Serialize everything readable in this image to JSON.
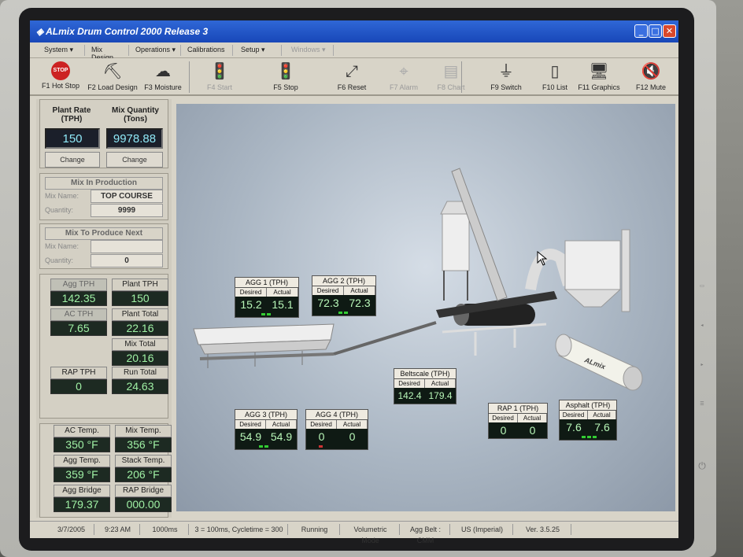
{
  "window": {
    "title": "ALmix Drum Control 2000 Release 3"
  },
  "menu": [
    {
      "label": "System",
      "enabled": true
    },
    {
      "label": "Mix Design",
      "enabled": true
    },
    {
      "label": "Operations",
      "enabled": true
    },
    {
      "label": "Calibrations",
      "enabled": true
    },
    {
      "label": "Setup",
      "enabled": true
    },
    {
      "label": "Windows",
      "enabled": false
    }
  ],
  "toolbar": [
    {
      "label": "F1 Hot Stop",
      "icon": "hot-stop-sign-icon",
      "glyph": "STOP",
      "enabled": true
    },
    {
      "label": "F2 Load Design",
      "icon": "load-design-icon",
      "glyph": "⛏",
      "enabled": true
    },
    {
      "label": "F3 Moisture",
      "icon": "cloud-icon",
      "glyph": "☁",
      "enabled": true
    },
    {
      "label": "F4 Start",
      "icon": "traffic-light-icon",
      "glyph": "🚦",
      "enabled": false
    },
    {
      "label": "F5 Stop",
      "icon": "traffic-light-icon",
      "glyph": "🚦",
      "enabled": true
    },
    {
      "label": "F6 Reset",
      "icon": "reset-icon",
      "glyph": "⤢",
      "enabled": true
    },
    {
      "label": "F7 Alarm",
      "icon": "crosshair-icon",
      "glyph": "⌖",
      "enabled": false
    },
    {
      "label": "F8 Chart",
      "icon": "chart-icon",
      "glyph": "▤",
      "enabled": false
    },
    {
      "label": "F9 Switch",
      "icon": "switch-icon",
      "glyph": "⏚",
      "enabled": true
    },
    {
      "label": "F10 List",
      "icon": "list-icon",
      "glyph": "▯",
      "enabled": true
    },
    {
      "label": "F11 Graphics",
      "icon": "computer-icon",
      "glyph": "🖥",
      "enabled": true
    },
    {
      "label": "F12 Mute",
      "icon": "mute-icon",
      "glyph": "🔇",
      "enabled": true
    }
  ],
  "plant": {
    "plant_rate_label": "Plant Rate (TPH)",
    "plant_rate": "150",
    "mix_quantity_label": "Mix Quantity (Tons)",
    "mix_quantity": "9978.88",
    "change_label": "Change"
  },
  "mix_in_production": {
    "header": "Mix In Production",
    "name_label": "Mix Name:",
    "name": "TOP COURSE",
    "quantity_label": "Quantity:",
    "quantity": "9999"
  },
  "mix_next": {
    "header": "Mix To Produce Next",
    "name_label": "Mix Name:",
    "name": "",
    "quantity_label": "Quantity:",
    "quantity": "0"
  },
  "gauges": {
    "agg_tph": {
      "label": "Agg TPH",
      "value": "142.35"
    },
    "plant_tph": {
      "label": "Plant TPH",
      "value": "150"
    },
    "ac_tph": {
      "label": "AC TPH",
      "value": "7.65"
    },
    "plant_total": {
      "label": "Plant Total",
      "value": "22.16"
    },
    "mix_total": {
      "label": "Mix Total",
      "value": "20.16"
    },
    "rap_tph": {
      "label": "RAP TPH",
      "value": "0"
    },
    "run_total": {
      "label": "Run Total",
      "value": "24.63"
    },
    "ac_temp": {
      "label": "AC Temp.",
      "value": "350 °F"
    },
    "mix_temp": {
      "label": "Mix Temp.",
      "value": "356 °F"
    },
    "agg_temp": {
      "label": "Agg Temp.",
      "value": "359 °F"
    },
    "stack_temp": {
      "label": "Stack Temp.",
      "value": "206 °F"
    },
    "agg_bridge": {
      "label": "Agg Bridge",
      "value": "179.37"
    },
    "rap_bridge": {
      "label": "RAP Bridge",
      "value": "000.00"
    }
  },
  "meters": {
    "desired_label": "Desired",
    "actual_label": "Actual",
    "agg1": {
      "title": "AGG 1 (TPH)",
      "desired": "15.2",
      "actual": "15.1"
    },
    "agg2": {
      "title": "AGG 2 (TPH)",
      "desired": "72.3",
      "actual": "72.3"
    },
    "agg3": {
      "title": "AGG 3 (TPH)",
      "desired": "54.9",
      "actual": "54.9"
    },
    "agg4": {
      "title": "AGG 4 (TPH)",
      "desired": "0",
      "actual": "0"
    },
    "beltscale": {
      "title": "Beltscale (TPH)",
      "desired": "142.4",
      "actual": "179.4"
    },
    "rap1": {
      "title": "RAP 1 (TPH)",
      "desired": "0",
      "actual": "0"
    },
    "asphalt": {
      "title": "Asphalt (TPH)",
      "desired": "7.6",
      "actual": "7.6"
    }
  },
  "tank_brand": "ALmix",
  "status": [
    "3/7/2005",
    "9:23 AM",
    "1000ms",
    "3 = 100ms, Cycletime = 300",
    "Running",
    "Volumetric Mode",
    "Agg Belt : CMM",
    "US (Imperial)",
    "Ver. 3.5.25"
  ],
  "colors": {
    "title_blue": "#1f55c4",
    "value_cyan": "#8fe8f7",
    "value_green": "#9ff0a4"
  }
}
